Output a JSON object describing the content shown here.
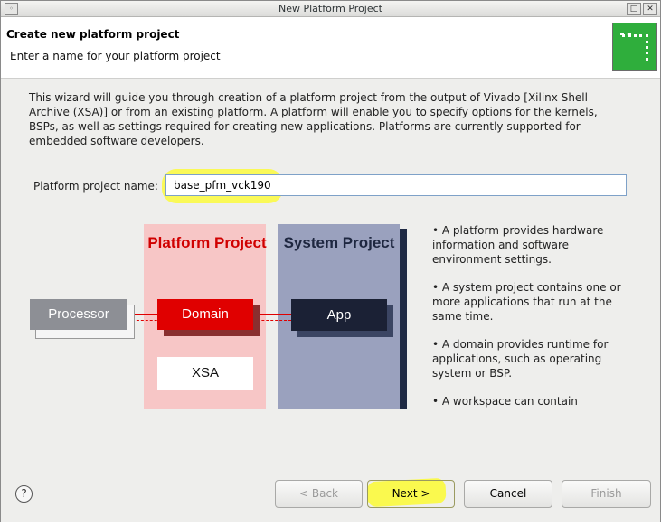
{
  "window": {
    "title": "New Platform Project",
    "menu_glyph": "◦",
    "maximize_glyph": "□",
    "close_glyph": "✕"
  },
  "header": {
    "title": "Create new platform project",
    "subtitle": "Enter a name for your platform project",
    "icon": "wizard-banner-icon",
    "icon_color": "#2fae3c"
  },
  "description": "This wizard will guide you through creation of a platform project from the output of Vivado [Xilinx Shell Archive (XSA)] or from an existing platform. A platform will enable you to specify options for the kernels, BSPs, as well as settings required for creating new applications. Platforms are currently supported for embedded software developers.",
  "form": {
    "name_label": "Platform project name:",
    "name_value": "base_pfm_vck190",
    "highlight_color": "#fbfa3d"
  },
  "diagram": {
    "platform_title": "Platform Project",
    "system_title": "System Project",
    "processor_label": "Processor",
    "domain_label": "Domain",
    "xsa_label": "XSA",
    "app_label": "App",
    "colors": {
      "platform_panel": "#f7c6c6",
      "system_panel": "#9aa1be",
      "domain_box": "#e00000",
      "app_box": "#1b2135",
      "processor_box": "#8d8f95"
    }
  },
  "bullets": [
    "• A platform provides hardware information and software environment settings.",
    "• A system project contains one or more applications that run at the same time.",
    "• A domain provides runtime for applications, such as operating system or BSP.",
    "• A workspace can contain"
  ],
  "footer": {
    "help_glyph": "?",
    "back_label": "< Back",
    "next_label": "Next >",
    "cancel_label": "Cancel",
    "finish_label": "Finish"
  }
}
